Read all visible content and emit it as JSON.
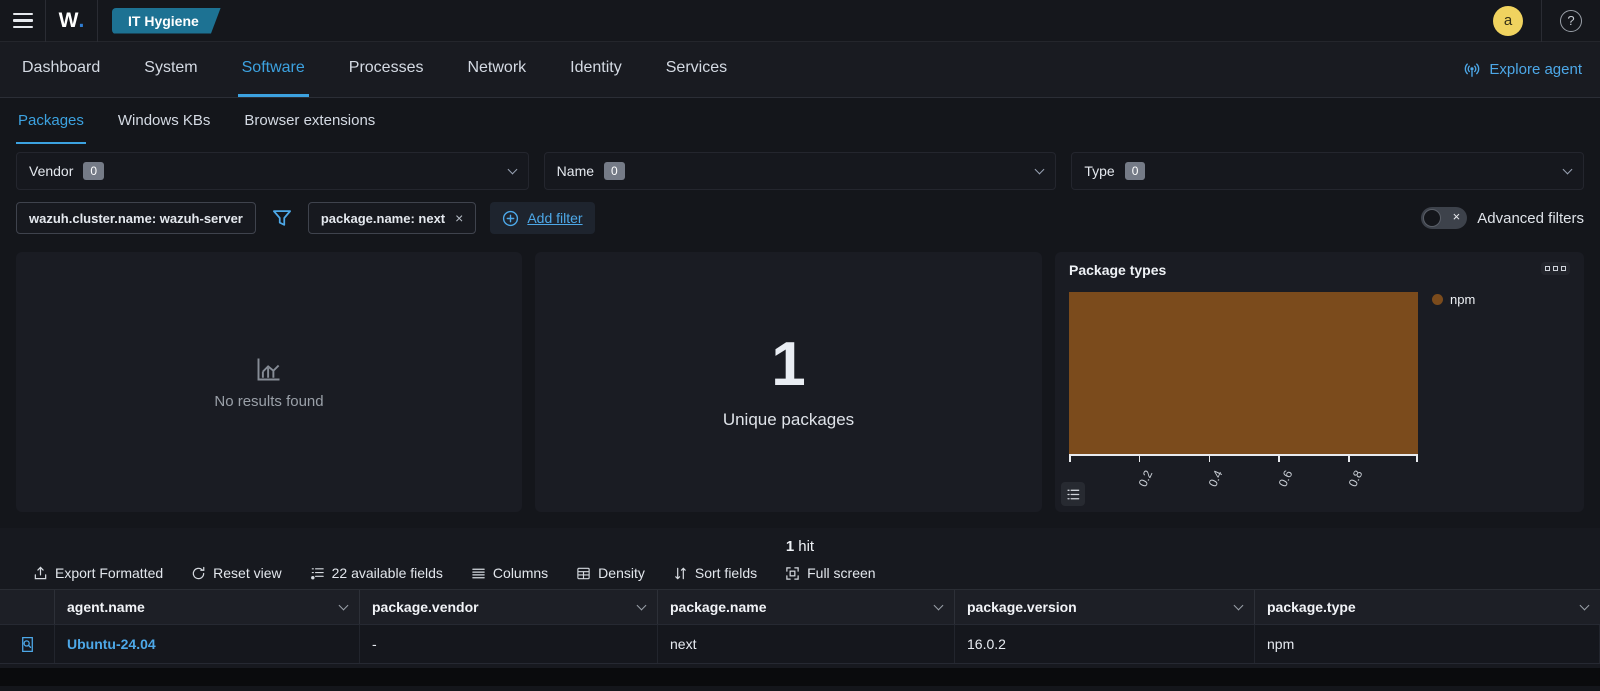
{
  "topbar": {
    "logo_text": "W",
    "logo_dot": ".",
    "breadcrumb": "IT Hygiene",
    "avatar_initial": "a",
    "help_glyph": "?"
  },
  "nav": {
    "tabs": [
      {
        "label": "Dashboard",
        "active": false
      },
      {
        "label": "System",
        "active": false
      },
      {
        "label": "Software",
        "active": true
      },
      {
        "label": "Processes",
        "active": false
      },
      {
        "label": "Network",
        "active": false
      },
      {
        "label": "Identity",
        "active": false
      },
      {
        "label": "Services",
        "active": false
      }
    ],
    "explore_agent_label": "Explore agent"
  },
  "subnav": {
    "tabs": [
      {
        "label": "Packages",
        "active": true
      },
      {
        "label": "Windows KBs",
        "active": false
      },
      {
        "label": "Browser extensions",
        "active": false
      }
    ]
  },
  "filters": {
    "selects": [
      {
        "label": "Vendor",
        "count": "0"
      },
      {
        "label": "Name",
        "count": "0"
      },
      {
        "label": "Type",
        "count": "0"
      }
    ],
    "pills": [
      {
        "text": "wazuh.cluster.name: wazuh-server"
      },
      {
        "text": "package.name: next",
        "close": "×"
      }
    ],
    "add_filter_label": "Add filter",
    "advanced_filters_label": "Advanced filters",
    "toggle_off_glyph": "×"
  },
  "panels": {
    "no_results_text": "No results found",
    "metric_value": "1",
    "metric_label": "Unique packages"
  },
  "chart_data": {
    "type": "bar",
    "orientation": "horizontal",
    "title": "Package types",
    "categories": [
      "npm"
    ],
    "values": [
      1
    ],
    "series": [
      {
        "name": "npm",
        "values": [
          1
        ],
        "color": "#7b4b1c"
      }
    ],
    "xlabel": "",
    "ylabel": "",
    "xlim": [
      0,
      1
    ],
    "x_ticks": [
      {
        "value": 0.2,
        "label": "0.2"
      },
      {
        "value": 0.4,
        "label": "0.4"
      },
      {
        "value": 0.6,
        "label": "0.6"
      },
      {
        "value": 0.8,
        "label": "0.8"
      }
    ],
    "legend_position": "right",
    "legend_entries": [
      "npm"
    ],
    "grid": false
  },
  "table": {
    "hits_value": "1",
    "hits_label": "hit",
    "toolbar": [
      {
        "label": "Export Formatted"
      },
      {
        "label": "Reset view"
      },
      {
        "label": "22 available fields"
      },
      {
        "label": "Columns"
      },
      {
        "label": "Density"
      },
      {
        "label": "Sort fields"
      },
      {
        "label": "Full screen"
      }
    ],
    "columns": [
      "agent.name",
      "package.vendor",
      "package.name",
      "package.version",
      "package.type"
    ],
    "rows": [
      {
        "agent_name": "Ubuntu-24.04",
        "package_vendor": "-",
        "package_name": "next",
        "package_version": "16.0.2",
        "package_type": "npm"
      }
    ]
  },
  "colors": {
    "accent_blue": "#3ca2e0",
    "link_blue": "#4da8e8",
    "bar_brown": "#7b4b1c",
    "avatar_yellow": "#f0d35f",
    "breadcrumb_badge_blue": "#1d7293",
    "count_badge_gray": "#757b87"
  }
}
